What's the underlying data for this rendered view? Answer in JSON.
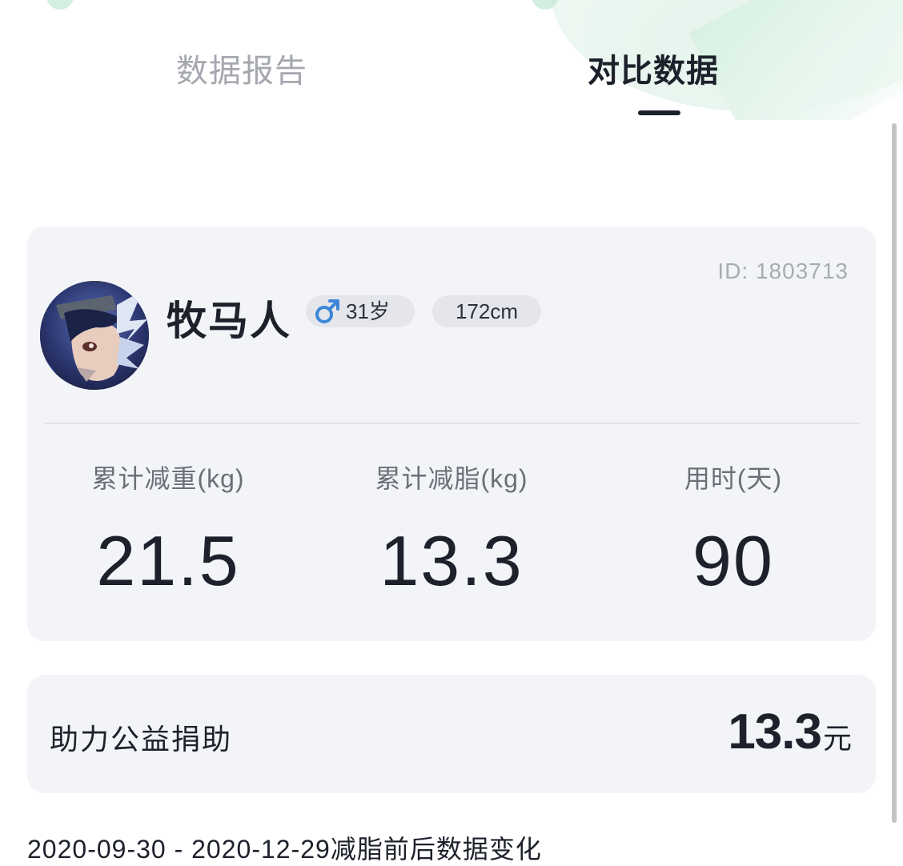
{
  "tabs": [
    {
      "label": "数据报告",
      "active": false
    },
    {
      "label": "对比数据",
      "active": true
    }
  ],
  "profile": {
    "id_text": "ID: 1803713",
    "name": "牧马人",
    "gender_icon": "male-icon",
    "age": "31岁",
    "height": "172cm"
  },
  "stats": [
    {
      "label": "累计减重(kg)",
      "value": "21.5"
    },
    {
      "label": "累计减脂(kg)",
      "value": "13.3"
    },
    {
      "label": "用时(天)",
      "value": "90"
    }
  ],
  "donation": {
    "label": "助力公益捐助",
    "value": "13.3",
    "unit": "元"
  },
  "period_text": "2020-09-30 - 2020-12-29减脂前后数据变化",
  "colors": {
    "card_bg": "#f3f4f8",
    "text_primary": "#1d212b",
    "text_muted": "#a4a7ae",
    "male_accent": "#3d86d8",
    "deco_green": "#dcf2e6"
  }
}
